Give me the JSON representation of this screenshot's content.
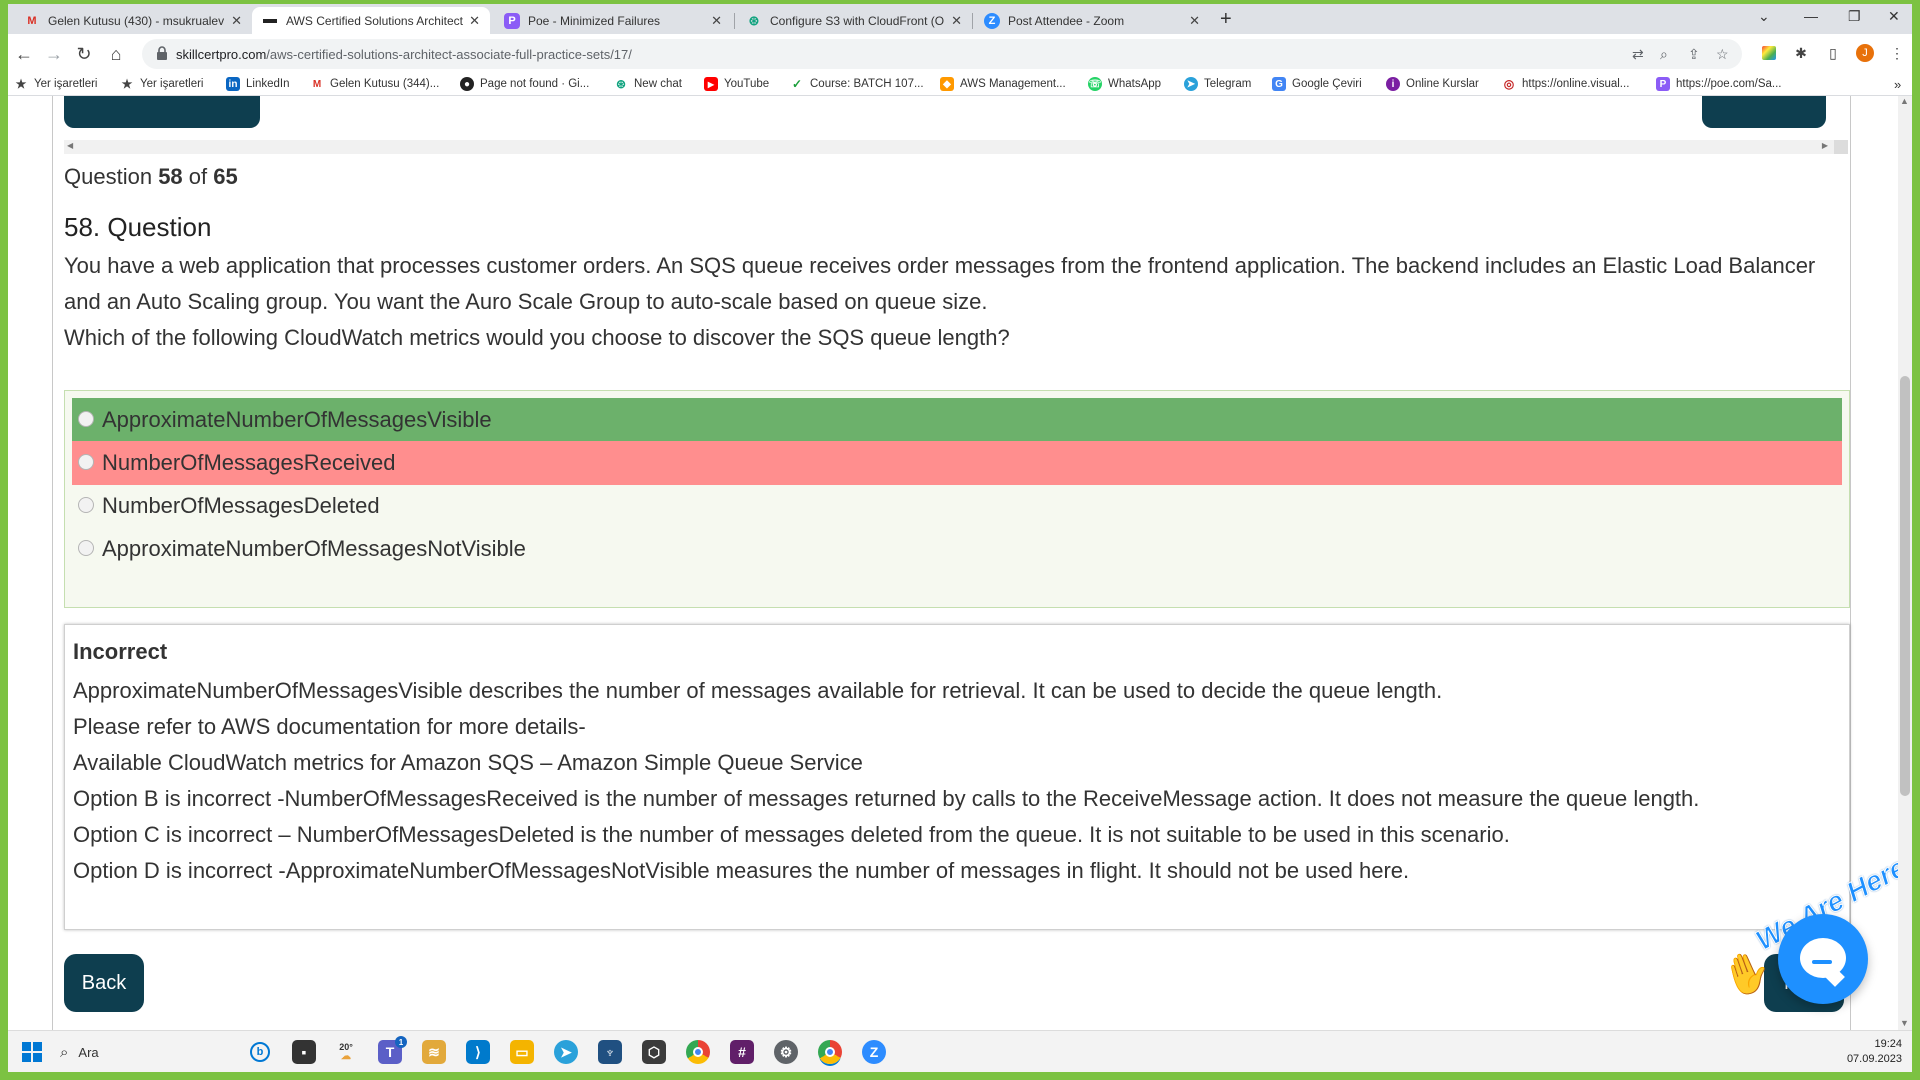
{
  "browser": {
    "tabs": [
      {
        "title": "Gelen Kutusu (430) - msukrualev",
        "icon": "gmail-icon",
        "active": false
      },
      {
        "title": "AWS Certified Solutions Architect",
        "icon": "skillcertpro-icon",
        "active": true
      },
      {
        "title": "Poe - Minimized Failures",
        "icon": "poe-icon",
        "active": false
      },
      {
        "title": "Configure S3 with CloudFront (O",
        "icon": "openai-icon",
        "active": false
      },
      {
        "title": "Post Attendee - Zoom",
        "icon": "zoom-icon",
        "active": false
      }
    ],
    "url_host": "skillcertpro.com",
    "url_path": "/aws-certified-solutions-architect-associate-full-practice-sets/17/",
    "profile_initial": "J"
  },
  "bookmarks": [
    {
      "label": "Yer işaretleri",
      "icon": "star-icon"
    },
    {
      "label": "Yer işaretleri",
      "icon": "star-icon"
    },
    {
      "label": "LinkedIn",
      "icon": "linkedin-icon"
    },
    {
      "label": "Gelen Kutusu (344)...",
      "icon": "gmail-icon"
    },
    {
      "label": "Page not found · Gi...",
      "icon": "github-icon"
    },
    {
      "label": "New chat",
      "icon": "openai-icon"
    },
    {
      "label": "YouTube",
      "icon": "youtube-icon"
    },
    {
      "label": "Course: BATCH 107...",
      "icon": "course-icon"
    },
    {
      "label": "AWS Management...",
      "icon": "aws-icon"
    },
    {
      "label": "WhatsApp",
      "icon": "whatsapp-icon"
    },
    {
      "label": "Telegram",
      "icon": "telegram-icon"
    },
    {
      "label": "Google Çeviri",
      "icon": "translate-icon"
    },
    {
      "label": "Online Kurslar",
      "icon": "online-kurslar-icon"
    },
    {
      "label": "https://online.visual...",
      "icon": "visual-icon"
    },
    {
      "label": "https://poe.com/Sa...",
      "icon": "poe-icon"
    }
  ],
  "quiz": {
    "counter_prefix": "Question",
    "current": "58",
    "counter_mid": "of",
    "total": "65",
    "question_title": "58. Question",
    "question_lines": [
      "You have a web application that processes customer orders. An SQS queue receives order messages from the frontend application. The backend includes an Elastic Load Balancer and an Auto Scaling group. You want the Auro Scale Group to auto-scale based on queue size.",
      "Which of the following CloudWatch metrics would you choose to discover the SQS queue length?"
    ],
    "options": [
      {
        "label": "ApproximateNumberOfMessagesVisible",
        "state": "correct"
      },
      {
        "label": "NumberOfMessagesReceived",
        "state": "wrong"
      },
      {
        "label": "NumberOfMessagesDeleted",
        "state": "none"
      },
      {
        "label": "ApproximateNumberOfMessagesNotVisible",
        "state": "none"
      }
    ],
    "result": "Incorrect",
    "explanation": [
      "ApproximateNumberOfMessagesVisible describes the number of messages available for retrieval. It can be used to decide the queue length.",
      "Please refer to AWS documentation for more details-",
      "Available CloudWatch metrics for Amazon SQS – Amazon Simple Queue Service",
      "Option B is incorrect -NumberOfMessagesReceived is the number of messages returned by calls to the ReceiveMessage action. It does not measure the queue length.",
      "Option C is incorrect – NumberOfMessagesDeleted is the number of messages deleted from the queue. It is not suitable to be used in this scenario.",
      "Option D is incorrect -ApproximateNumberOfMessagesNotVisible measures the number of messages in flight. It should not be used here."
    ],
    "back_label": "Back",
    "next_label": "N"
  },
  "chat_widget": {
    "label": "We Are Here!"
  },
  "taskbar": {
    "search_placeholder": "Ara",
    "weather": "20°",
    "teams_badge": "1",
    "time": "19:24",
    "date": "07.09.2023"
  },
  "colors": {
    "correct": "#6cb16b",
    "wrong": "#ff8e8e",
    "button": "#0e3e4f",
    "border_green": "#7cc242",
    "chat_blue": "#1e90ff"
  }
}
